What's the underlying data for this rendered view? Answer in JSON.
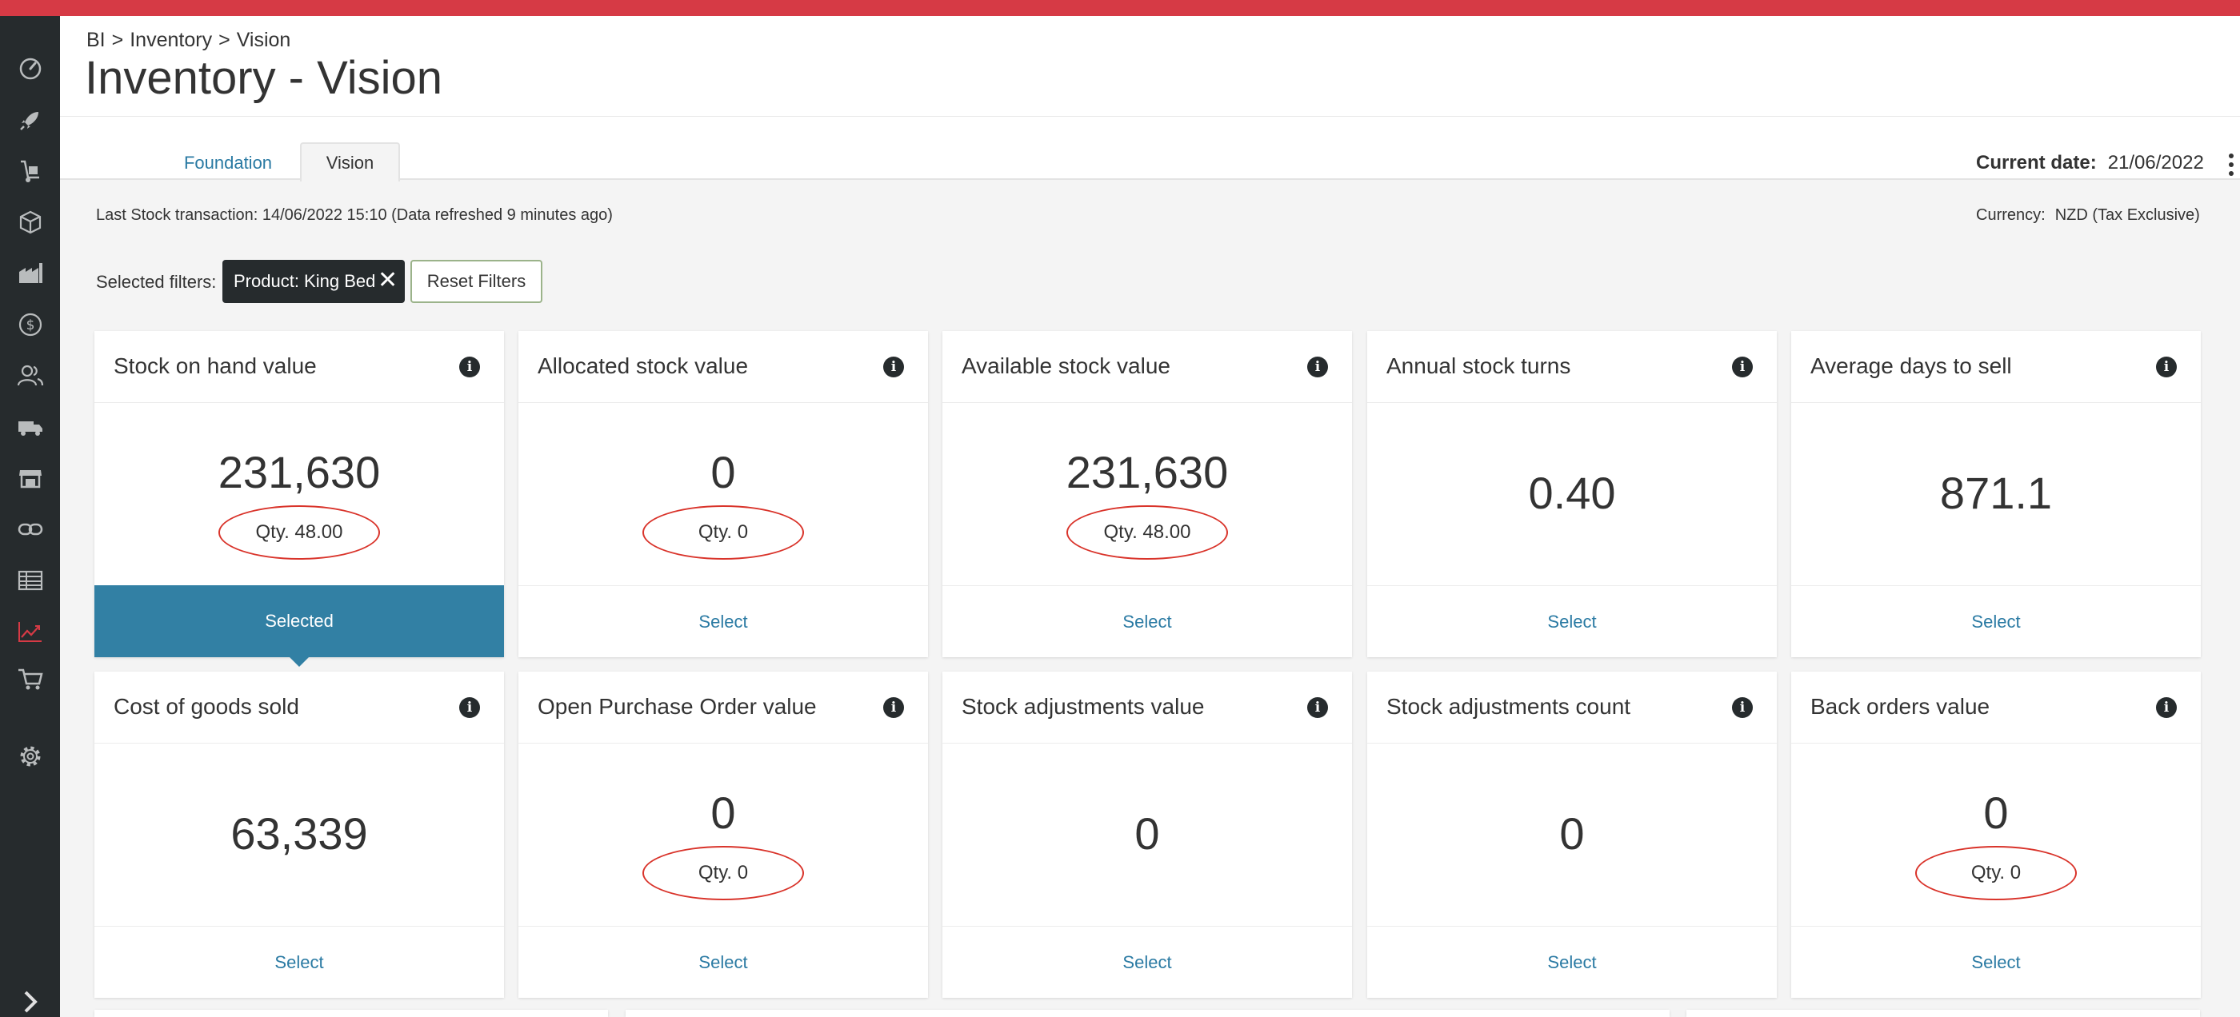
{
  "header": {
    "breadcrumb": [
      "BI",
      "Inventory",
      "Vision"
    ],
    "breadcrumb_sep": ">",
    "title": "Inventory - Vision",
    "tabs": [
      {
        "label": "Foundation",
        "active": false
      },
      {
        "label": "Vision",
        "active": true
      }
    ],
    "current_date_label": "Current date:",
    "current_date_value": "21/06/2022"
  },
  "info_bar": {
    "last_stock": "Last Stock transaction: 14/06/2022 15:10 (Data refreshed 9 minutes ago)",
    "currency_label": "Currency:",
    "currency_value": "NZD (Tax Exclusive)"
  },
  "filters": {
    "label": "Selected filters:",
    "chip": "Product: King Bed",
    "chip_remove": "✕",
    "reset_label": "Reset Filters"
  },
  "info_glyph": "i",
  "cards": [
    {
      "title": "Stock on hand value",
      "value": "231,630",
      "qty": "Qty. 48.00",
      "action": "Selected",
      "selected": true
    },
    {
      "title": "Allocated stock value",
      "value": "0",
      "qty": "Qty. 0",
      "action": "Select",
      "selected": false
    },
    {
      "title": "Available stock value",
      "value": "231,630",
      "qty": "Qty. 48.00",
      "action": "Select",
      "selected": false
    },
    {
      "title": "Annual stock turns",
      "value": "0.40",
      "qty": null,
      "action": "Select",
      "selected": false
    },
    {
      "title": "Average days to sell",
      "value": "871.1",
      "qty": null,
      "action": "Select",
      "selected": false
    },
    {
      "title": "Cost of goods sold",
      "value": "63,339",
      "qty": null,
      "action": "Select",
      "selected": false
    },
    {
      "title": "Open Purchase Order value",
      "value": "0",
      "qty": "Qty. 0",
      "action": "Select",
      "selected": false
    },
    {
      "title": "Stock adjustments value",
      "value": "0",
      "qty": null,
      "action": "Select",
      "selected": false
    },
    {
      "title": "Stock adjustments count",
      "value": "0",
      "qty": null,
      "action": "Select",
      "selected": false
    },
    {
      "title": "Back orders value",
      "value": "0",
      "qty": "Qty. 0",
      "action": "Select",
      "selected": false
    }
  ],
  "sidebar": {
    "icons": [
      "dashboard-icon",
      "rocket-icon",
      "hand-truck-icon",
      "box-icon",
      "factory-icon",
      "dollar-icon",
      "users-icon",
      "truck-icon",
      "store-icon",
      "link-icon",
      "table-icon",
      "chart-icon",
      "cart-icon",
      "gear-icon",
      "expand-icon"
    ],
    "active_icon": "chart-icon"
  },
  "colors": {
    "topbar": "#d63a45",
    "sidebar": "#262b2d",
    "selected": "#3280a4",
    "link": "#2a7aa3",
    "highlight_ring": "#d9342b"
  }
}
